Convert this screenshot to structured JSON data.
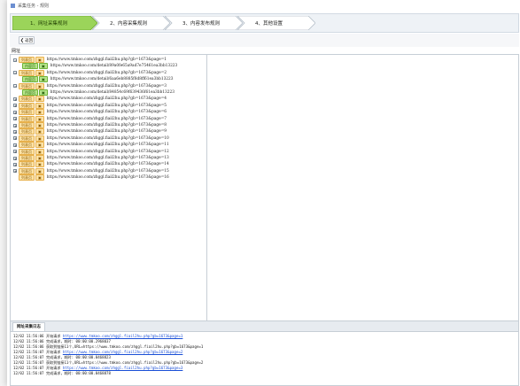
{
  "window": {
    "title": "采集任务 - 规则"
  },
  "steps": [
    {
      "label": "1、网址采集规则",
      "active": true
    },
    {
      "label": "2、内容采集规则",
      "active": false
    },
    {
      "label": "3、内容发布规则",
      "active": false
    },
    {
      "label": "4、其他设置",
      "active": false
    }
  ],
  "back_button": {
    "label": "返回"
  },
  "tree": {
    "root_label": "网址",
    "nodes": [
      {
        "type": "list",
        "tag": "列表页",
        "url": "https://www.tmkoo.com/zhggl.fiail2hu.php?gb=1673&page=1",
        "exp": "−"
      },
      {
        "type": "detail",
        "tag": "内容页",
        "url": "https://www.tmkoo.com/detail/89a0fe65a9ad7e75461ea3bb13223"
      },
      {
        "type": "list",
        "tag": "列表页",
        "url": "https://www.tmkoo.com/zhggl.fiail2hu.php?gb=1673&page=2",
        "exp": "−"
      },
      {
        "type": "detail",
        "tag": "内容页",
        "url": "https://www.tmkoo.com/detail/6aa6eb8885f8d8ff61ea3bb13223"
      },
      {
        "type": "list",
        "tag": "列表页",
        "url": "https://www.tmkoo.com/zhggl.fiail2hu.php?gb=1673&page=3",
        "exp": "−"
      },
      {
        "type": "detail",
        "tag": "内容页",
        "url": "https://www.tmkoo.com/detail/84854c69f639436f61ea3bb13223"
      },
      {
        "type": "list",
        "tag": "列表页",
        "url": "https://www.tmkoo.com/zhggl.fiail2hu.php?gb=1673&page=4",
        "exp": "+"
      },
      {
        "type": "list",
        "tag": "列表页",
        "url": "https://www.tmkoo.com/zhggl.fiail2hu.php?gb=1673&page=5",
        "exp": "+"
      },
      {
        "type": "list",
        "tag": "列表页",
        "url": "https://www.tmkoo.com/zhggl.fiail2hu.php?gb=1673&page=6",
        "exp": "+"
      },
      {
        "type": "list",
        "tag": "列表页",
        "url": "https://www.tmkoo.com/zhggl.fiail2hu.php?gb=1673&page=7",
        "exp": "+"
      },
      {
        "type": "list",
        "tag": "列表页",
        "url": "https://www.tmkoo.com/zhggl.fiail2hu.php?gb=1673&page=8",
        "exp": "+"
      },
      {
        "type": "list",
        "tag": "列表页",
        "url": "https://www.tmkoo.com/zhggl.fiail2hu.php?gb=1673&page=9",
        "exp": "+"
      },
      {
        "type": "list",
        "tag": "列表页",
        "url": "https://www.tmkoo.com/zhggl.fiail2hu.php?gb=1673&page=10",
        "exp": "+"
      },
      {
        "type": "list",
        "tag": "列表页",
        "url": "https://www.tmkoo.com/zhggl.fiail2hu.php?gb=1673&page=11",
        "exp": "+"
      },
      {
        "type": "list",
        "tag": "列表页",
        "url": "https://www.tmkoo.com/zhggl.fiail2hu.php?gb=1673&page=12",
        "exp": "+"
      },
      {
        "type": "list",
        "tag": "列表页",
        "url": "https://www.tmkoo.com/zhggl.fiail2hu.php?gb=1673&page=13",
        "exp": "+"
      },
      {
        "type": "list",
        "tag": "列表页",
        "url": "https://www.tmkoo.com/zhggl.fiail2hu.php?gb=1673&page=14",
        "exp": "+"
      },
      {
        "type": "list",
        "tag": "列表页",
        "url": "https://www.tmkoo.com/zhggl.fiail2hu.php?gb=1673&page=15",
        "exp": "+"
      },
      {
        "type": "list",
        "tag": "列表页",
        "url": "https://www.tmkoo.com/zhggl.fiail2hu.php?gb=1673&page=16",
        "exp": ""
      }
    ]
  },
  "log": {
    "tab_label": "网址采集日志",
    "lines": [
      {
        "prefix": "12/02 11:56:06 开始请求 ",
        "link": "https://www.tmkoo.com/zhggl.fiail2hu.php?gb=1673&page=1",
        "suffix": ""
      },
      {
        "prefix": "12/02 11:56:06 完成请求，耗时: 00:00:00.2968037",
        "link": "",
        "suffix": ""
      },
      {
        "prefix": "12/02 11:56:06 获取到链接11个,URL=https://www.tmkoo.com/zhggl.fiail2hu.php?gb=1673&page=1",
        "link": "",
        "suffix": ""
      },
      {
        "prefix": "12/02 11:56:07 开始请求 ",
        "link": "https://www.tmkoo.com/zhggl.fiail2hu.php?gb=1673&page=2",
        "suffix": ""
      },
      {
        "prefix": "12/02 11:56:07 完成请求，耗时: 00:00:00.0468823",
        "link": "",
        "suffix": ""
      },
      {
        "prefix": "12/02 11:56:07 获取到链接11个,URL=https://www.tmkoo.com/zhggl.fiail2hu.php?gb=1673&page=2",
        "link": "",
        "suffix": ""
      },
      {
        "prefix": "12/02 11:56:07 开始请求 ",
        "link": "https://www.tmkoo.com/zhggl.fiail2hu.php?gb=1673&page=3",
        "suffix": ""
      },
      {
        "prefix": "12/02 11:56:07 完成请求，耗时: 00:00:00.0468878",
        "link": "",
        "suffix": ""
      }
    ]
  },
  "colors": {
    "step_active": "#9bd45a",
    "step_inactive": "#ffffff",
    "tag_list": "#fde3a7",
    "tag_detail": "#b6e58a",
    "link": "#1a4fd6"
  }
}
